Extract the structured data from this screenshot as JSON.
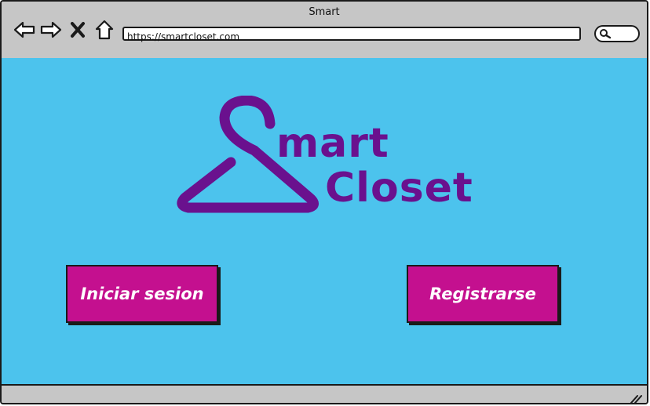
{
  "window": {
    "title": "Smart"
  },
  "toolbar": {
    "back_icon": "back-arrow-icon",
    "forward_icon": "forward-arrow-icon",
    "close_icon": "close-icon",
    "home_icon": "home-icon",
    "search_icon": "search-icon"
  },
  "address_bar": {
    "url": "https://smartcloset.com"
  },
  "logo": {
    "line1": "mart",
    "line2": "Closet",
    "icon": "hanger-icon",
    "color": "#6a118e"
  },
  "buttons": {
    "login_label": "Iniciar sesion",
    "register_label": "Registrarse",
    "color": "#c4108f"
  },
  "colors": {
    "content_bg": "#4cc3ed",
    "chrome_bg": "#c6c6c6"
  }
}
